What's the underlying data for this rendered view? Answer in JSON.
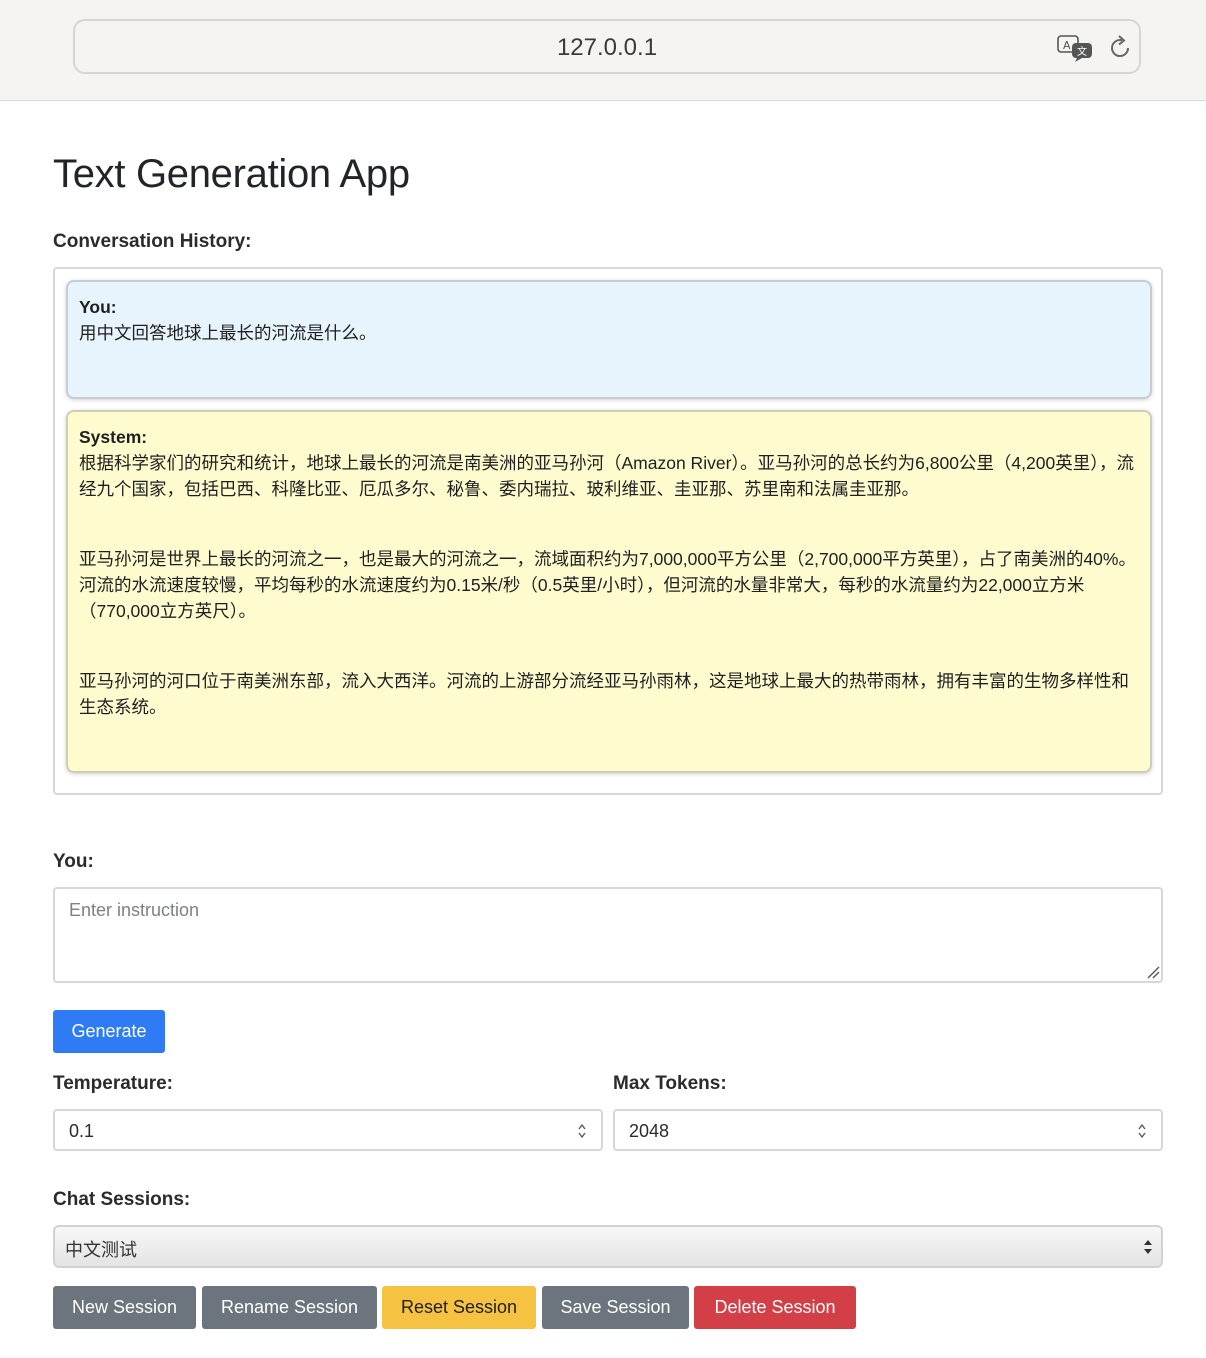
{
  "browser": {
    "url": "127.0.0.1"
  },
  "page": {
    "title": "Text Generation App"
  },
  "history": {
    "label": "Conversation History:",
    "messages": [
      {
        "role": "You:",
        "paragraphs": [
          "用中文回答地球上最长的河流是什么。"
        ]
      },
      {
        "role": "System:",
        "paragraphs": [
          "根据科学家们的研究和统计，地球上最长的河流是南美洲的亚马孙河（Amazon River）。亚马孙河的总长约为6,800公里（4,200英里），流经九个国家，包括巴西、科隆比亚、厄瓜多尔、秘鲁、委内瑞拉、玻利维亚、圭亚那、苏里南和法属圭亚那。",
          "亚马孙河是世界上最长的河流之一，也是最大的河流之一，流域面积约为7,000,000平方公里（2,700,000平方英里），占了南美洲的40%。河流的水流速度较慢，平均每秒的水流速度约为0.15米/秒（0.5英里/小时），但河流的水量非常大，每秒的水流量约为22,000立方米（770,000立方英尺）。",
          "亚马孙河的河口位于南美洲东部，流入大西洋。河流的上游部分流经亚马孙雨林，这是地球上最大的热带雨林，拥有丰富的生物多样性和生态系统。"
        ]
      }
    ]
  },
  "input": {
    "label": "You:",
    "placeholder": "Enter instruction",
    "value": ""
  },
  "generate_label": "Generate",
  "temperature": {
    "label": "Temperature:",
    "value": "0.1"
  },
  "max_tokens": {
    "label": "Max Tokens:",
    "value": "2048"
  },
  "sessions": {
    "label": "Chat Sessions:",
    "selected": "中文测试",
    "buttons": {
      "new": "New Session",
      "rename": "Rename Session",
      "reset": "Reset Session",
      "save": "Save Session",
      "delete": "Delete Session"
    }
  },
  "colors": {
    "primary": "#2f7bf5",
    "secondary": "#6c757d",
    "warning": "#f5c242",
    "danger": "#d23f46",
    "user_bubble": "#e7f3fd",
    "system_bubble": "#fefccf"
  }
}
